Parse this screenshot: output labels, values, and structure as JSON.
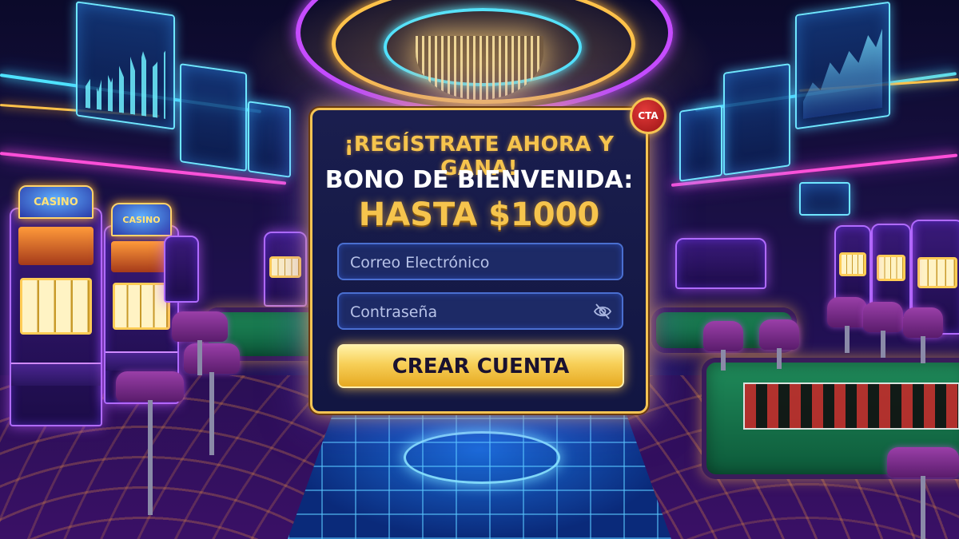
{
  "promo": {
    "badge": "CTA",
    "headline": "¡REGÍSTRATE AHORA Y GANA!",
    "subheadline": "BONO DE BIENVENIDA:",
    "amount": "HASTA $1000"
  },
  "form": {
    "email_placeholder": "Correo Electrónico",
    "email_value": "",
    "password_placeholder": "Contraseña",
    "password_value": "",
    "password_toggle_icon": "eye-slash-icon",
    "submit_label": "CREAR CUENTA"
  },
  "background": {
    "slot_topper_text": "CASINO",
    "slot_topper_text_2": "CASINO"
  },
  "colors": {
    "accent_gold": "#f6c44d",
    "panel_bg": "#1a1e4e",
    "field_bg": "#1d2a66",
    "button_text": "#1a1230"
  }
}
